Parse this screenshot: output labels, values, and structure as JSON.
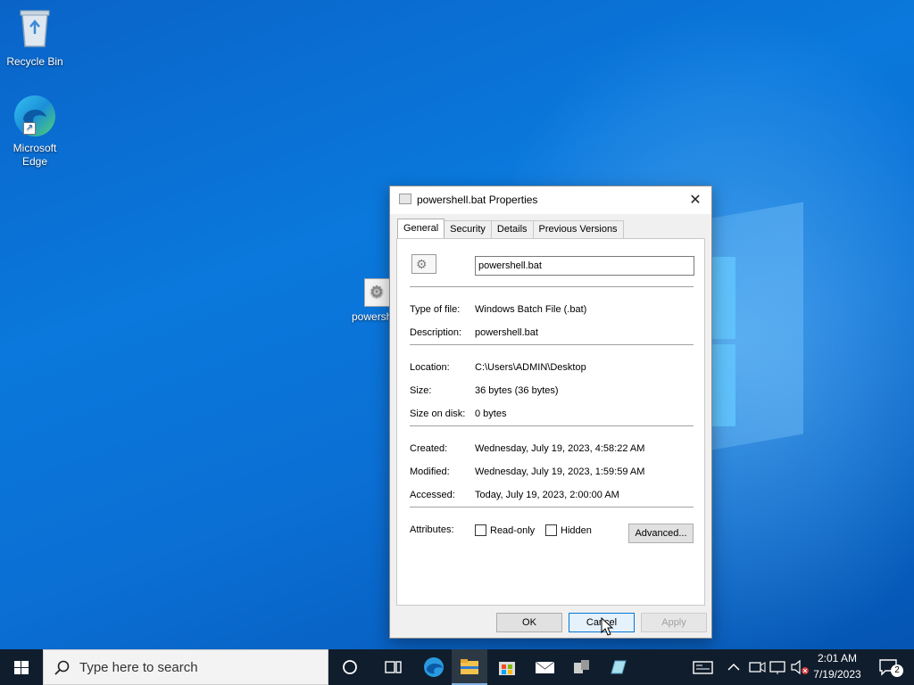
{
  "desktop": {
    "icons": [
      {
        "label": "Recycle Bin"
      },
      {
        "label": "Microsoft Edge"
      },
      {
        "label": "powershell.bat"
      }
    ]
  },
  "dialog": {
    "title": "powershell.bat Properties",
    "tabs": [
      "General",
      "Security",
      "Details",
      "Previous Versions"
    ],
    "active_tab": "General",
    "file_name": "powershell.bat",
    "fields": {
      "type_label": "Type of file:",
      "type_value": "Windows Batch File (.bat)",
      "desc_label": "Description:",
      "desc_value": "powershell.bat",
      "location_label": "Location:",
      "location_value": "C:\\Users\\ADMIN\\Desktop",
      "size_label": "Size:",
      "size_value": "36 bytes (36 bytes)",
      "size_on_disk_label": "Size on disk:",
      "size_on_disk_value": "0 bytes",
      "created_label": "Created:",
      "created_value": "Wednesday, July 19, 2023, 4:58:22 AM",
      "modified_label": "Modified:",
      "modified_value": "Wednesday, July 19, 2023, 1:59:59 AM",
      "accessed_label": "Accessed:",
      "accessed_value": "Today, July 19, 2023, 2:00:00 AM",
      "attributes_label": "Attributes:"
    },
    "attributes": {
      "readonly_label": "Read-only",
      "hidden_label": "Hidden",
      "advanced_label": "Advanced..."
    },
    "buttons": {
      "ok": "OK",
      "cancel": "Cancel",
      "apply": "Apply"
    }
  },
  "taskbar": {
    "search_placeholder": "Type here to search",
    "clock_time": "2:01 AM",
    "clock_date": "7/19/2023",
    "notification_count": "2"
  },
  "colors": {
    "accent": "#0078d7",
    "taskbar": "#101d2c"
  }
}
